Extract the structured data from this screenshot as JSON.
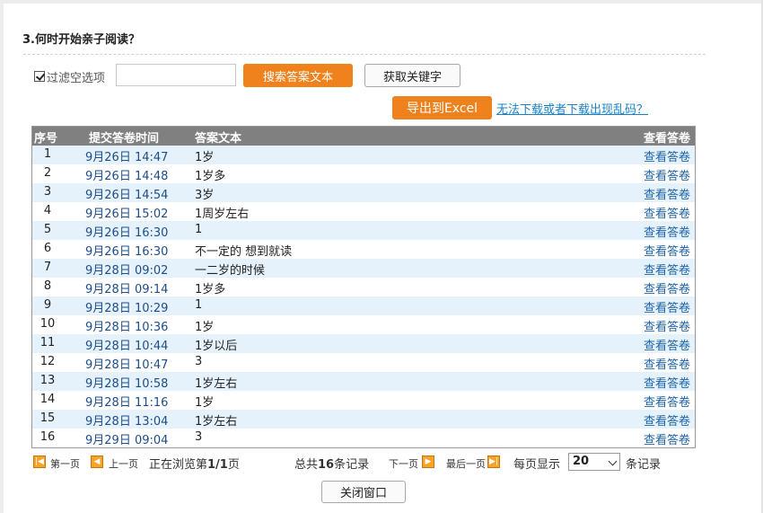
{
  "question": {
    "title": "3.何时开始亲子阅读？"
  },
  "filter": {
    "checkbox_label": "过滤空选项",
    "checked": true,
    "search_value": "",
    "search_label": "搜索答案文本",
    "keyword_label": "获取关键字"
  },
  "export": {
    "button_label": "导出到Excel",
    "help_link": "无法下载或者下载出现乱码？"
  },
  "table": {
    "headers": [
      "序号",
      "提交答卷时间",
      "答案文本",
      "查看答卷"
    ],
    "rows": [
      {
        "no": "1",
        "time": "9月26日 14:47",
        "answer": "1岁",
        "view": "查看答卷"
      },
      {
        "no": "2",
        "time": "9月26日 14:48",
        "answer": "1岁多",
        "view": "查看答卷"
      },
      {
        "no": "3",
        "time": "9月26日 14:54",
        "answer": "3岁",
        "view": "查看答卷"
      },
      {
        "no": "4",
        "time": "9月26日 15:02",
        "answer": "1周岁左右",
        "view": "查看答卷"
      },
      {
        "no": "5",
        "time": "9月26日 16:30",
        "answer": "1",
        "view": "查看答卷"
      },
      {
        "no": "6",
        "time": "9月26日 16:30",
        "answer": "不一定的 想到就读",
        "view": "查看答卷"
      },
      {
        "no": "7",
        "time": "9月28日 09:02",
        "answer": "一二岁的时候",
        "view": "查看答卷"
      },
      {
        "no": "8",
        "time": "9月28日 09:14",
        "answer": "1岁多",
        "view": "查看答卷"
      },
      {
        "no": "9",
        "time": "9月28日 10:29",
        "answer": "1",
        "view": "查看答卷"
      },
      {
        "no": "10",
        "time": "9月28日 10:36",
        "answer": "1岁",
        "view": "查看答卷"
      },
      {
        "no": "11",
        "time": "9月28日 10:44",
        "answer": "1岁以后",
        "view": "查看答卷"
      },
      {
        "no": "12",
        "time": "9月28日 10:47",
        "answer": "3",
        "view": "查看答卷"
      },
      {
        "no": "13",
        "time": "9月28日 10:58",
        "answer": "1岁左右",
        "view": "查看答卷"
      },
      {
        "no": "14",
        "time": "9月28日 11:16",
        "answer": "1岁",
        "view": "查看答卷"
      },
      {
        "no": "15",
        "time": "9月28日 13:04",
        "answer": "1岁左右",
        "view": "查看答卷"
      },
      {
        "no": "16",
        "time": "9月29日 09:04",
        "answer": "3",
        "view": "查看答卷"
      }
    ]
  },
  "pager": {
    "first": "第一页",
    "prev": "上一页",
    "browsing_prefix": "正在浏览第",
    "browsing_value": "1/1",
    "browsing_suffix": "页",
    "total_prefix": "总共",
    "total_value": "16",
    "total_suffix": "条记录",
    "next": "下一页",
    "last": "最后一页",
    "pagesize_prefix": "每页显示",
    "pagesize_value": "20",
    "pagesize_suffix": "条记录"
  },
  "close": {
    "label": "关闭窗口"
  }
}
